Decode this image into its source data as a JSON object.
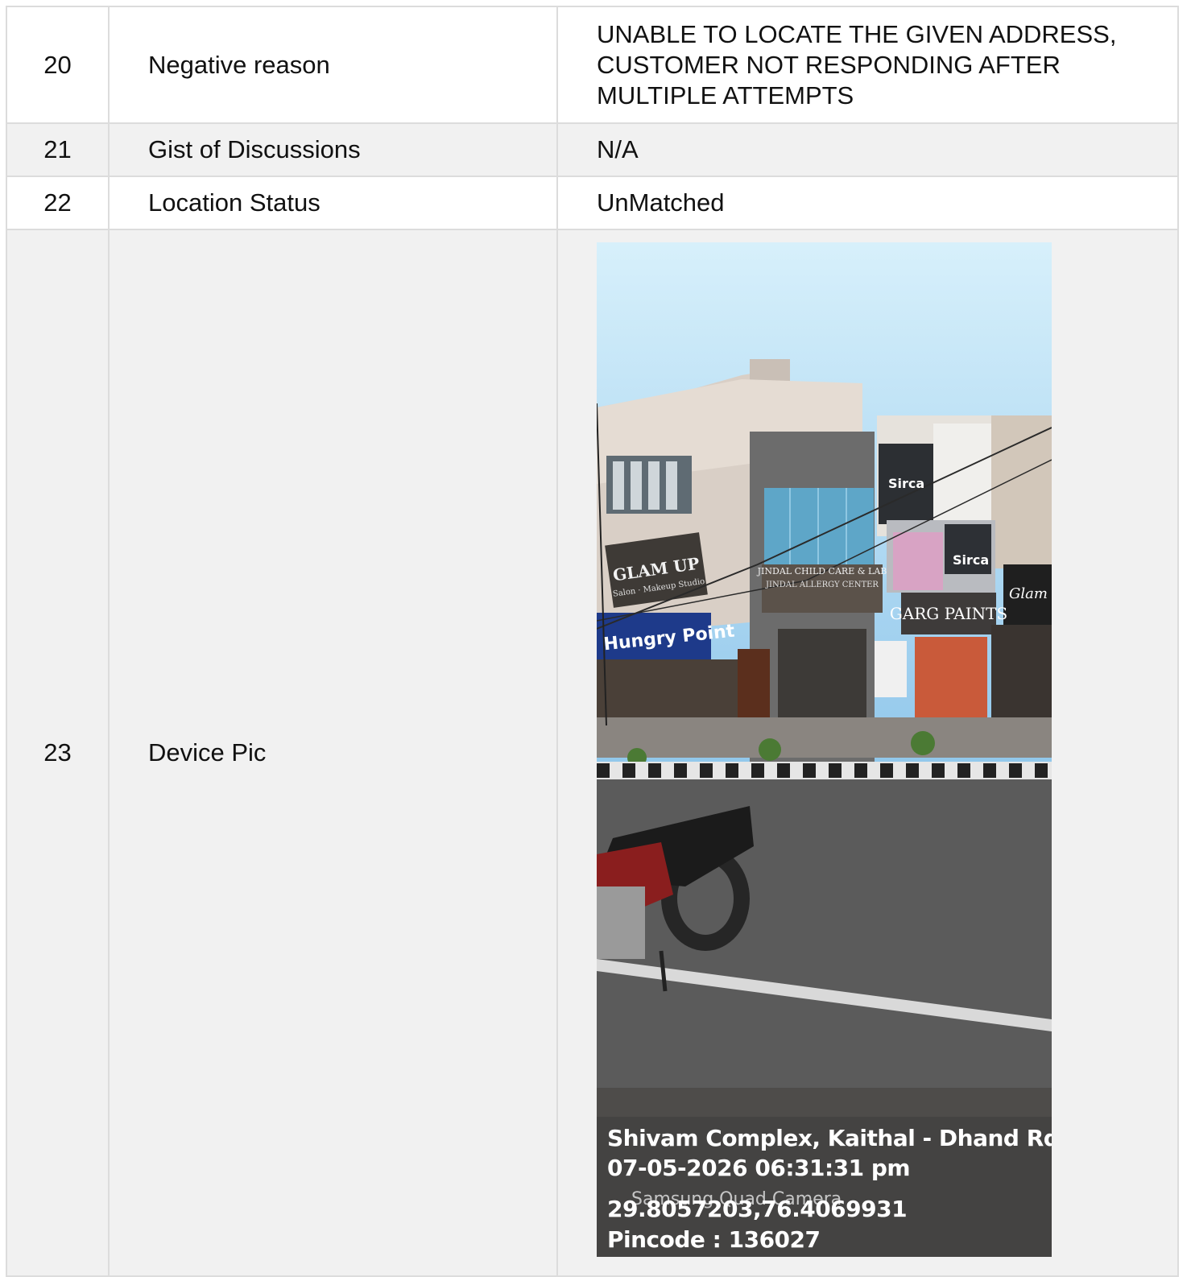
{
  "rows": [
    {
      "num": "20",
      "label": "Negative reason",
      "value": "UNABLE TO LOCATE THE GIVEN ADDRESS, CUSTOMER NOT RESPONDING AFTER MULTIPLE ATTEMPTS"
    },
    {
      "num": "21",
      "label": "Gist of Discussions",
      "value": "N/A"
    },
    {
      "num": "22",
      "label": "Location Status",
      "value": "UnMatched"
    },
    {
      "num": "23",
      "label": "Device Pic"
    }
  ],
  "photo": {
    "address_line": "Shivam Complex, Kaithal - Dhand Rd, ...",
    "datetime": "07-05-2026 06:31:31 pm",
    "watermark": "Samsung Quad Camera",
    "coordinates": "29.8057203,76.4069931",
    "pincode": "Pincode : 136027",
    "signs": {
      "glam_up": "GLAM UP",
      "glam_up_sub": "Salon · Makeup Studio",
      "hungry_point": "Hungry Point",
      "child_care": "JINDAL CHILD CARE & LAB",
      "allergy": "JINDAL ALLERGY CENTER",
      "sirca": "Sirca",
      "garg_paints": "GARG PAINTS",
      "glam_right": "Glam"
    }
  }
}
